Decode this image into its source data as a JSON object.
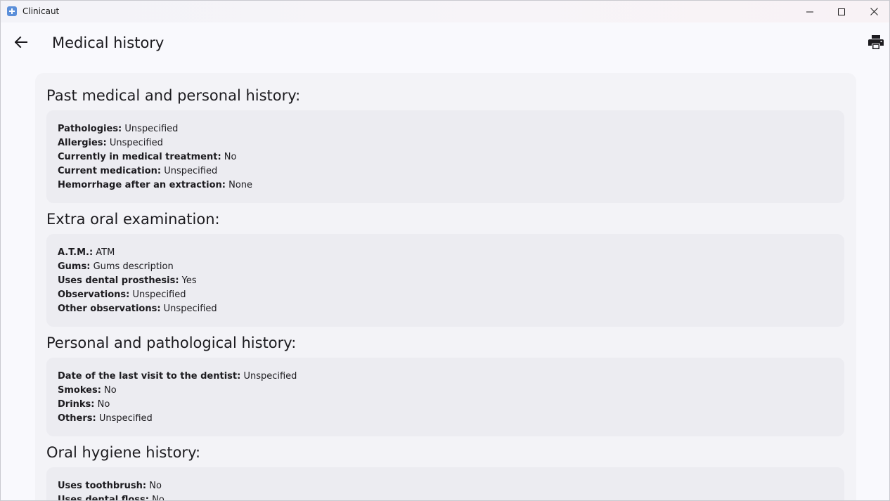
{
  "window": {
    "app_title": "Clinicaut",
    "app_icon": "app-logo-icon",
    "minimize_icon": "minimize-icon",
    "maximize_icon": "maximize-icon",
    "close_icon": "close-icon"
  },
  "appbar": {
    "title": "Medical history",
    "back_icon": "arrow-back-icon",
    "print_icon": "print-icon"
  },
  "colors": {
    "background": "#f9f9fd",
    "card": "#f3f3f7",
    "section_box": "#ececf1",
    "text": "#1c1b1f",
    "app_icon": "#5b8fd9"
  },
  "sections": [
    {
      "title": "Past medical and personal history:",
      "fields": [
        {
          "label": "Pathologies:",
          "value": "Unspecified"
        },
        {
          "label": "Allergies:",
          "value": "Unspecified"
        },
        {
          "label": "Currently in medical treatment:",
          "value": "No"
        },
        {
          "label": "Current medication:",
          "value": "Unspecified"
        },
        {
          "label": "Hemorrhage after an extraction:",
          "value": "None"
        }
      ]
    },
    {
      "title": "Extra oral examination:",
      "fields": [
        {
          "label": "A.T.M.:",
          "value": "ATM"
        },
        {
          "label": "Gums:",
          "value": "Gums description"
        },
        {
          "label": "Uses dental prosthesis:",
          "value": "Yes"
        },
        {
          "label": "Observations:",
          "value": "Unspecified"
        },
        {
          "label": "Other observations:",
          "value": "Unspecified"
        }
      ]
    },
    {
      "title": "Personal and pathological history:",
      "fields": [
        {
          "label": "Date of the last visit to the dentist:",
          "value": "Unspecified"
        },
        {
          "label": "Smokes:",
          "value": "No"
        },
        {
          "label": "Drinks:",
          "value": "No"
        },
        {
          "label": "Others:",
          "value": "Unspecified"
        }
      ]
    },
    {
      "title": "Oral hygiene history:",
      "fields": [
        {
          "label": "Uses toothbrush:",
          "value": "No"
        },
        {
          "label": "Uses dental floss:",
          "value": "No"
        }
      ]
    }
  ]
}
